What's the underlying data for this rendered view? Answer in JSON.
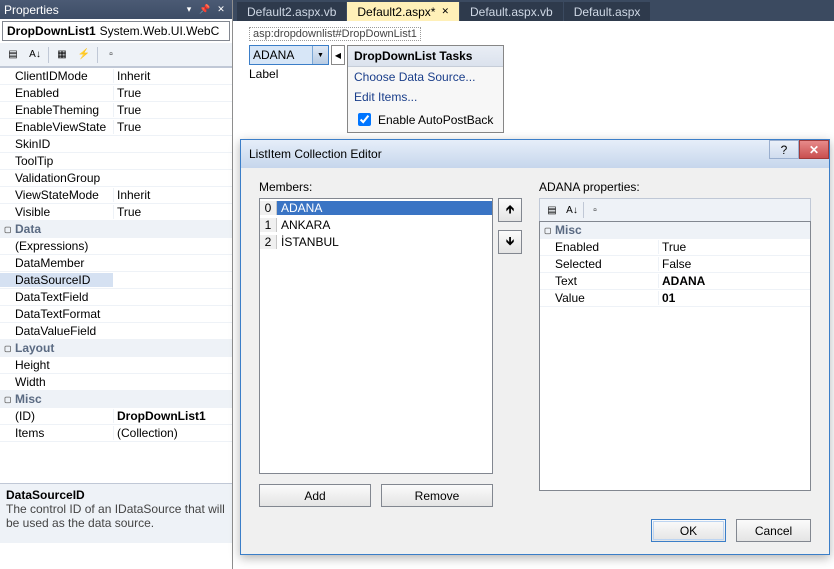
{
  "propertiesPanel": {
    "title": "Properties",
    "selectedObject": {
      "name": "DropDownList1",
      "type": "System.Web.UI.WebC"
    },
    "rows": [
      {
        "kind": "item",
        "name": "ClientIDMode",
        "value": "Inherit"
      },
      {
        "kind": "item",
        "name": "Enabled",
        "value": "True"
      },
      {
        "kind": "item",
        "name": "EnableTheming",
        "value": "True"
      },
      {
        "kind": "item",
        "name": "EnableViewState",
        "value": "True"
      },
      {
        "kind": "item",
        "name": "SkinID",
        "value": ""
      },
      {
        "kind": "item",
        "name": "ToolTip",
        "value": ""
      },
      {
        "kind": "item",
        "name": "ValidationGroup",
        "value": ""
      },
      {
        "kind": "item",
        "name": "ViewStateMode",
        "value": "Inherit"
      },
      {
        "kind": "item",
        "name": "Visible",
        "value": "True"
      },
      {
        "kind": "cat",
        "name": "Data"
      },
      {
        "kind": "item",
        "name": "(Expressions)",
        "value": ""
      },
      {
        "kind": "item",
        "name": "DataMember",
        "value": ""
      },
      {
        "kind": "item",
        "name": "DataSourceID",
        "value": "",
        "selected": true
      },
      {
        "kind": "item",
        "name": "DataTextField",
        "value": ""
      },
      {
        "kind": "item",
        "name": "DataTextFormat",
        "value": ""
      },
      {
        "kind": "item",
        "name": "DataValueField",
        "value": ""
      },
      {
        "kind": "cat",
        "name": "Layout"
      },
      {
        "kind": "item",
        "name": "Height",
        "value": ""
      },
      {
        "kind": "item",
        "name": "Width",
        "value": ""
      },
      {
        "kind": "cat",
        "name": "Misc"
      },
      {
        "kind": "item",
        "name": "(ID)",
        "value": "DropDownList1",
        "bold": true
      },
      {
        "kind": "item",
        "name": "Items",
        "value": "(Collection)"
      }
    ],
    "help": {
      "name": "DataSourceID",
      "desc": "The control ID of an IDataSource that will be used as the data source."
    }
  },
  "tabs": [
    {
      "label": "Default2.aspx.vb",
      "active": false
    },
    {
      "label": "Default2.aspx*",
      "active": true
    },
    {
      "label": "Default.aspx.vb",
      "active": false
    },
    {
      "label": "Default.aspx",
      "active": false
    }
  ],
  "designer": {
    "breadcrumb": "asp:dropdownlist#DropDownList1",
    "ddlSelected": "ADANA",
    "labelText": "Label"
  },
  "smartTasks": {
    "title": "DropDownList Tasks",
    "chooseDataSource": "Choose Data Source...",
    "editItems": "Edit Items...",
    "enableAutoPost": "Enable AutoPostBack",
    "autoPostChecked": true
  },
  "dialog": {
    "title": "ListItem Collection Editor",
    "membersLabel": "Members:",
    "members": [
      {
        "index": "0",
        "text": "ADANA",
        "selected": true
      },
      {
        "index": "1",
        "text": "ANKARA",
        "selected": false
      },
      {
        "index": "2",
        "text": "İSTANBUL",
        "selected": false
      }
    ],
    "add": "Add",
    "remove": "Remove",
    "propsLabel": "ADANA properties:",
    "propGrid": {
      "category": "Misc",
      "rows": [
        {
          "name": "Enabled",
          "value": "True"
        },
        {
          "name": "Selected",
          "value": "False"
        },
        {
          "name": "Text",
          "value": "ADANA",
          "bold": true
        },
        {
          "name": "Value",
          "value": "01",
          "bold": true
        }
      ]
    },
    "ok": "OK",
    "cancel": "Cancel"
  }
}
